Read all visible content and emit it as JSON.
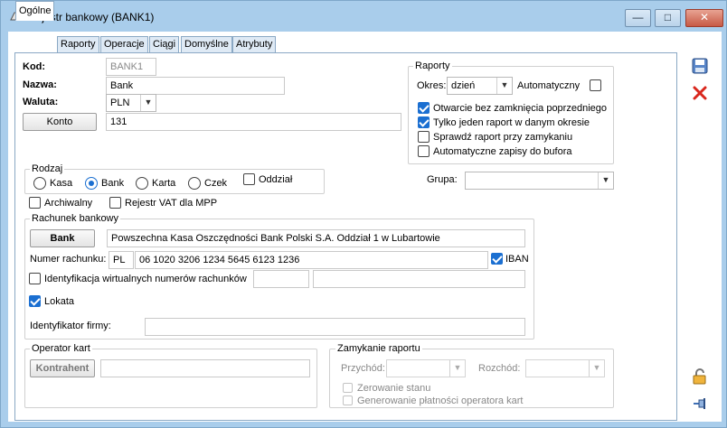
{
  "window": {
    "title": "Rejestr bankowy (BANK1)",
    "minimize": "—",
    "maximize": "□",
    "close": "✕"
  },
  "tabs": [
    "Ogólne",
    "Raporty",
    "Operacje",
    "Ciągi",
    "Domyślne",
    "Atrybuty"
  ],
  "form": {
    "kod_label": "Kod:",
    "kod_value": "BANK1",
    "nazwa_label": "Nazwa:",
    "nazwa_value": "Bank",
    "waluta_label": "Waluta:",
    "waluta_value": "PLN",
    "konto_button": "Konto",
    "konto_value": "131"
  },
  "raporty": {
    "title": "Raporty",
    "okres_label": "Okres:",
    "okres_value": "dzień",
    "automatyczny_label": "Automatyczny",
    "automatyczny_checked": false,
    "options": [
      {
        "label": "Otwarcie bez zamknięcia poprzedniego",
        "checked": true
      },
      {
        "label": "Tylko jeden raport w danym okresie",
        "checked": true
      },
      {
        "label": "Sprawdź raport przy zamykaniu",
        "checked": false
      },
      {
        "label": "Automatyczne zapisy do bufora",
        "checked": false
      }
    ]
  },
  "rodzaj": {
    "title": "Rodzaj",
    "options": [
      "Kasa",
      "Bank",
      "Karta",
      "Czek"
    ],
    "selected": "Bank",
    "oddzial_label": "Oddział"
  },
  "grupa": {
    "label": "Grupa:",
    "value": ""
  },
  "flags": {
    "archiwalny": "Archiwalny",
    "rejestr_vat": "Rejestr VAT dla MPP"
  },
  "rachunek": {
    "title": "Rachunek bankowy",
    "bank_button": "Bank",
    "bank_name": "Powszechna Kasa Oszczędności Bank Polski S.A. Oddział 1 w Lubartowie",
    "numer_label": "Numer rachunku:",
    "country": "PL",
    "number": "06 1020 3206 1234 5645 6123 1236",
    "iban_label": "IBAN",
    "iban_checked": true,
    "identyfikacja_label": "Identyfikacja wirtualnych numerów rachunków",
    "lokata_label": "Lokata",
    "lokata_checked": true,
    "identyfikator_label": "Identyfikator firmy:"
  },
  "operator": {
    "title": "Operator kart",
    "kontrahent_button": "Kontrahent"
  },
  "zamykanie": {
    "title": "Zamykanie raportu",
    "przychod_label": "Przychód:",
    "rozchod_label": "Rozchód:",
    "zerowanie_label": "Zerowanie stanu",
    "generowanie_label": "Generowanie płatności operatora kart"
  },
  "side_icons": [
    "save-icon",
    "cancel-icon",
    "lock-icon",
    "pin-icon"
  ],
  "colors": {
    "titlebar": "#a9cdeb",
    "accent": "#1b6fd1",
    "cancel": "#d9261c",
    "save": "#3f6fb5"
  }
}
